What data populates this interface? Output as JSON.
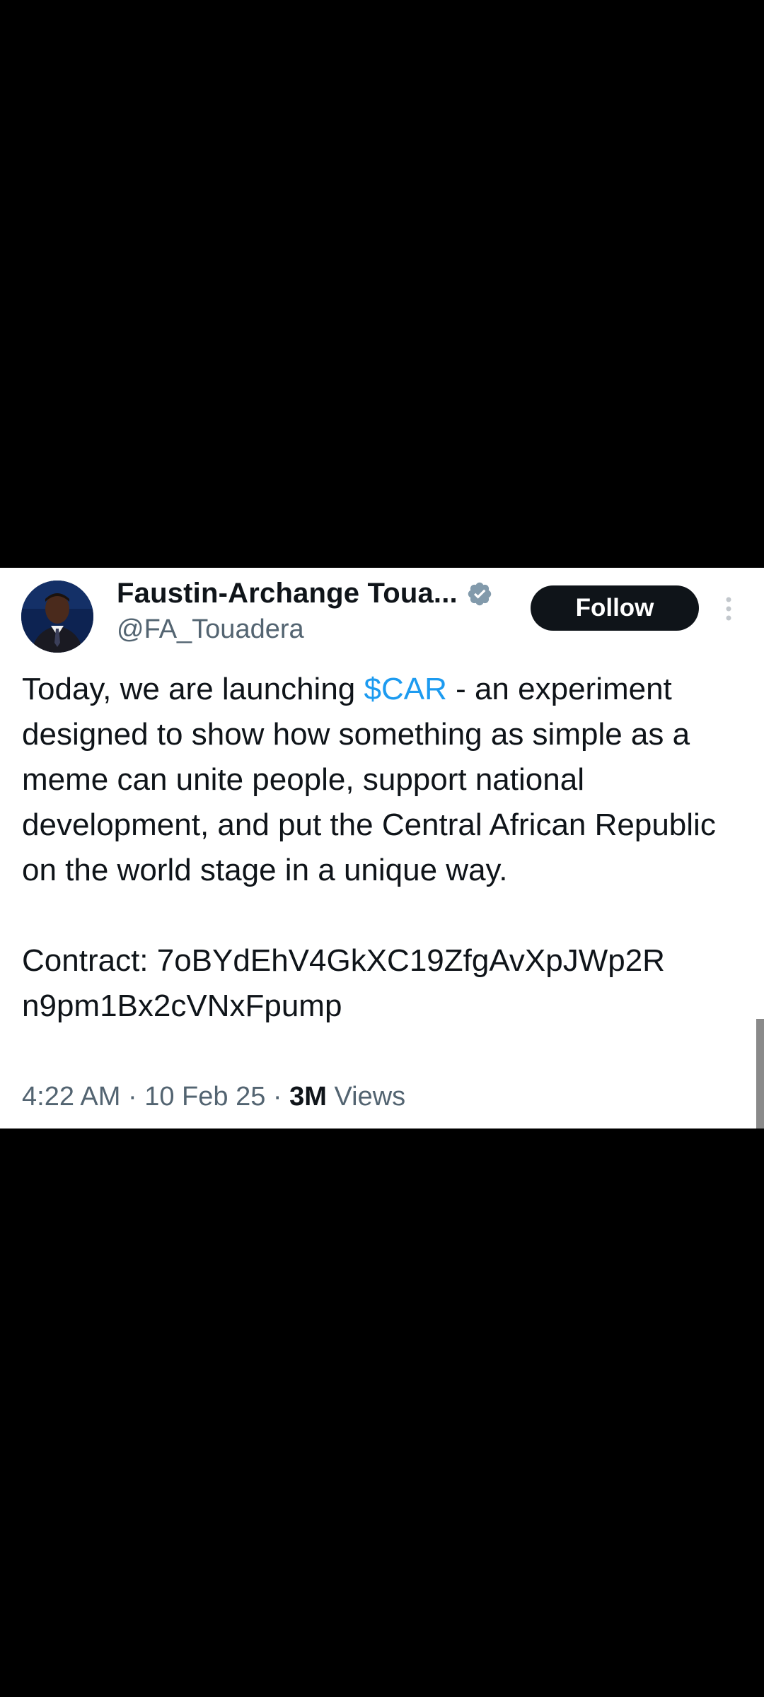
{
  "tweet": {
    "author": {
      "display_name": "Faustin-Archange Toua...",
      "handle": "@FA_Touadera",
      "verified_icon": "verified-badge-icon",
      "avatar_icon": "profile-avatar"
    },
    "follow_label": "Follow",
    "more_icon": "more-vertical-icon",
    "text_part1": "Today, we are launching ",
    "cashtag": "$CAR",
    "text_part2": " - an experiment designed to show how something as simple as a meme can unite people, support national development, and put the Central African Republic on the world stage in a unique way.",
    "contract_line1": "Contract: 7oBYdEhV4GkXC19ZfgAvXpJWp2R",
    "contract_line2": "n9pm1Bx2cVNxFpump",
    "time": "4:22 AM",
    "separator": " · ",
    "date": "10 Feb 25",
    "views_count": "3M",
    "views_label": " Views"
  },
  "colors": {
    "background": "#000000",
    "card": "#ffffff",
    "text": "#0f1419",
    "secondary_text": "#536471",
    "link": "#1d9bf0",
    "verified": "#829aab",
    "follow_button": "#0f1419"
  }
}
